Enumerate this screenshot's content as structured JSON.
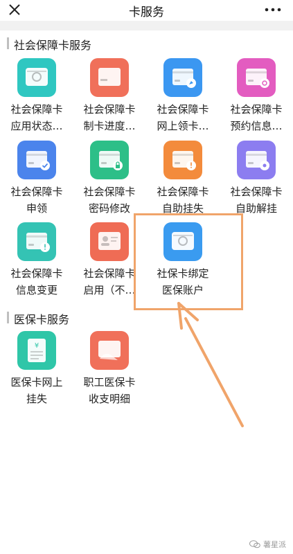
{
  "header": {
    "title": "卡服务"
  },
  "sections": [
    {
      "title": "社会保障卡服务",
      "items": [
        {
          "line1": "社会保障卡",
          "line2": "应用状态…",
          "icon": "card-status-icon",
          "color": "#2fc7c1"
        },
        {
          "line1": "社会保障卡",
          "line2": "制卡进度…",
          "icon": "card-progress-icon",
          "color": "#f0705a"
        },
        {
          "line1": "社会保障卡",
          "line2": "网上领卡…",
          "icon": "card-online-claim-icon",
          "color": "#3b97f1"
        },
        {
          "line1": "社会保障卡",
          "line2": "预约信息…",
          "icon": "card-appointment-icon",
          "color": "#e35cc0"
        },
        {
          "line1": "社会保障卡",
          "line2": "申领",
          "icon": "card-apply-icon",
          "color": "#4b84ec"
        },
        {
          "line1": "社会保障卡",
          "line2": "密码修改",
          "icon": "card-password-icon",
          "color": "#2dbf88"
        },
        {
          "line1": "社会保障卡",
          "line2": "自助挂失",
          "icon": "card-report-loss-icon",
          "color": "#f38b3c"
        },
        {
          "line1": "社会保障卡",
          "line2": "自助解挂",
          "icon": "card-unlock-icon",
          "color": "#8c7df0"
        },
        {
          "line1": "社会保障卡",
          "line2": "信息变更",
          "icon": "card-info-change-icon",
          "color": "#34c3b4"
        },
        {
          "line1": "社会保障卡",
          "line2": "启用（不…",
          "icon": "card-activate-icon",
          "color": "#ef6c55"
        },
        {
          "line1": "社保卡绑定",
          "line2": "医保账户",
          "icon": "card-bind-insurance-icon",
          "color": "#3a9bf0"
        }
      ]
    },
    {
      "title": "医保卡服务",
      "items": [
        {
          "line1": "医保卡网上",
          "line2": "挂失",
          "icon": "medical-card-report-loss-icon",
          "color": "#2fc6a8"
        },
        {
          "line1": "职工医保卡",
          "line2": "收支明细",
          "icon": "medical-card-statement-icon",
          "color": "#f0705a"
        }
      ]
    }
  ],
  "watermark": {
    "text": "薯星派"
  }
}
